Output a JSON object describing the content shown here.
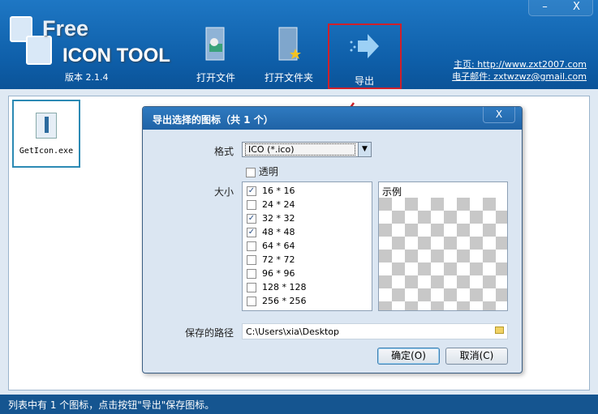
{
  "app": {
    "logo_top": "Free",
    "logo_bottom": "ICON TOOL",
    "version": "版本 2.1.4",
    "minimize": "–",
    "close": "X"
  },
  "toolbar": [
    {
      "label": "打开文件"
    },
    {
      "label": "打开文件夹"
    },
    {
      "label": "导出"
    }
  ],
  "links": {
    "home": "主页: http://www.zxt2007.com",
    "email": "电子邮件: zxtwzwz@gmail.com"
  },
  "files": [
    {
      "name": "GetIcon.exe"
    }
  ],
  "dialog": {
    "title": "导出选择的图标（共 1 个）",
    "close": "X",
    "format_label": "格式",
    "format_value": "ICO (*.ico)",
    "transparent_label": "透明",
    "size_label": "大小",
    "sizes": [
      {
        "label": "16 * 16",
        "checked": true
      },
      {
        "label": "24 * 24",
        "checked": false
      },
      {
        "label": "32 * 32",
        "checked": true
      },
      {
        "label": "48 * 48",
        "checked": true
      },
      {
        "label": "64 * 64",
        "checked": false
      },
      {
        "label": "72 * 72",
        "checked": false
      },
      {
        "label": "96 * 96",
        "checked": false
      },
      {
        "label": "128 * 128",
        "checked": false
      },
      {
        "label": "256 * 256",
        "checked": false
      }
    ],
    "preview_label": "示例",
    "path_label": "保存的路径",
    "path_value": "C:\\Users\\xia\\Desktop",
    "ok": "确定(O)",
    "cancel": "取消(C)"
  },
  "status": "列表中有 1 个图标，点击按钮\"导出\"保存图标。",
  "colors": {
    "header": "#0e5ea8",
    "highlight": "#d0202a",
    "status": "#155590"
  }
}
